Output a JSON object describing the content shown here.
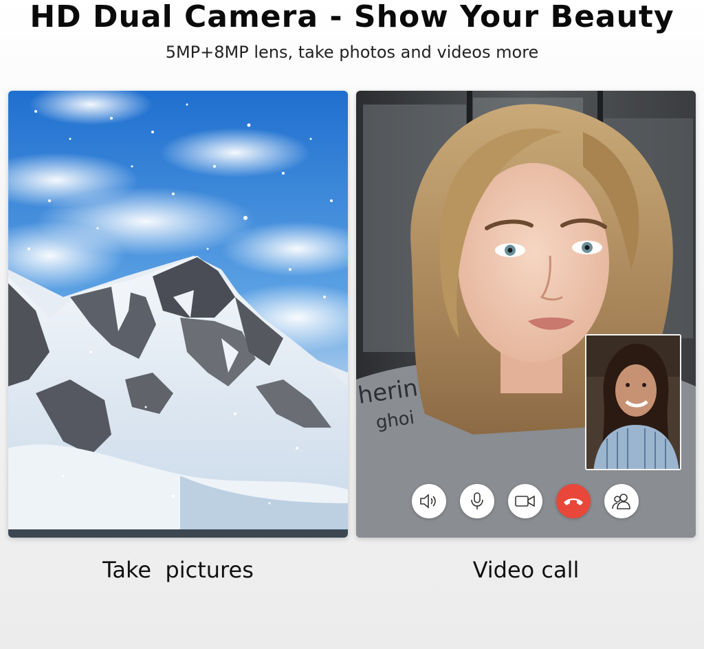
{
  "header": {
    "title": "HD Dual Camera - Show Your Beauty",
    "subtitle": "5MP+8MP lens, take photos and videos more"
  },
  "panels": {
    "left": {
      "image": "snowy-mountain-photo",
      "caption": "Take  pictures"
    },
    "right": {
      "image": "video-call-photo",
      "caption": "Video call",
      "shirt_text": "herin ghoi",
      "controls": [
        {
          "icon": "speaker-icon"
        },
        {
          "icon": "microphone-icon"
        },
        {
          "icon": "video-camera-icon"
        },
        {
          "icon": "hang-up-icon"
        },
        {
          "icon": "contacts-icon"
        }
      ]
    }
  },
  "colors": {
    "sky": "#2a7fd6",
    "hang_up": "#e8473a",
    "background": "#f1f1f1"
  }
}
